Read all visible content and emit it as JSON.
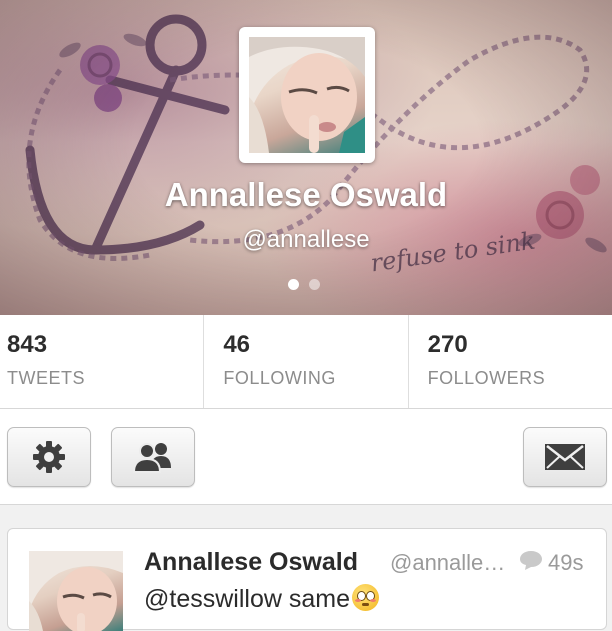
{
  "profile": {
    "name": "Annallese Oswald",
    "handle": "@annallese",
    "header_art_text": "refuse to sink",
    "avatar": "profile-photo",
    "carousel_pages": 2,
    "carousel_active": 1
  },
  "stats": [
    {
      "value": "843",
      "label": "TWEETS"
    },
    {
      "value": "46",
      "label": "FOLLOWING"
    },
    {
      "value": "270",
      "label": "FOLLOWERS"
    }
  ],
  "actions": {
    "settings_icon": "gear-icon",
    "people_icon": "people-icon",
    "message_icon": "envelope-icon"
  },
  "tweet": {
    "name": "Annallese Oswald",
    "handle": "@annalle…",
    "time": "49s",
    "text": "@tesswillow same",
    "emoji": "flushed-face-emoji",
    "reply_icon": "speech-bubble-icon"
  },
  "colors": {
    "text_dark": "#2d2d2d",
    "text_muted": "#8c8c8c",
    "background": "#f1f1f1"
  }
}
